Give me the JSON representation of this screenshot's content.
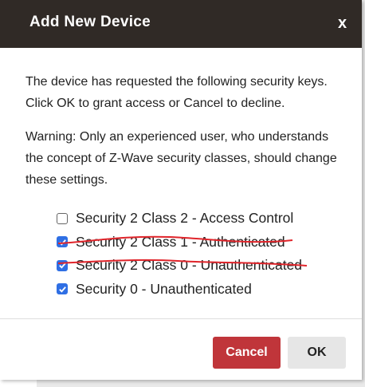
{
  "dialog": {
    "title": "Add New Device",
    "close_label": "x",
    "message": "The device has requested the following security keys. Click OK to grant access or Cancel to decline.",
    "warning": "Warning: Only an experienced user, who understands the concept of Z-Wave security classes, should change these settings.",
    "options": [
      {
        "label": "Security 2 Class 2 - Access Control",
        "checked": false
      },
      {
        "label": "Security 2 Class 1 - Authenticated",
        "checked": true
      },
      {
        "label": "Security 2 Class 0 - Unauthenticated",
        "checked": true
      },
      {
        "label": "Security 0 - Unauthenticated",
        "checked": true
      }
    ],
    "cancel_label": "Cancel",
    "ok_label": "OK"
  },
  "colors": {
    "header_bg": "#302a26",
    "checkbox_checked": "#2f6fe4",
    "cancel_bg": "#c0353a",
    "ok_bg": "#e6e6e6",
    "strike_annotation": "#e0252b"
  }
}
